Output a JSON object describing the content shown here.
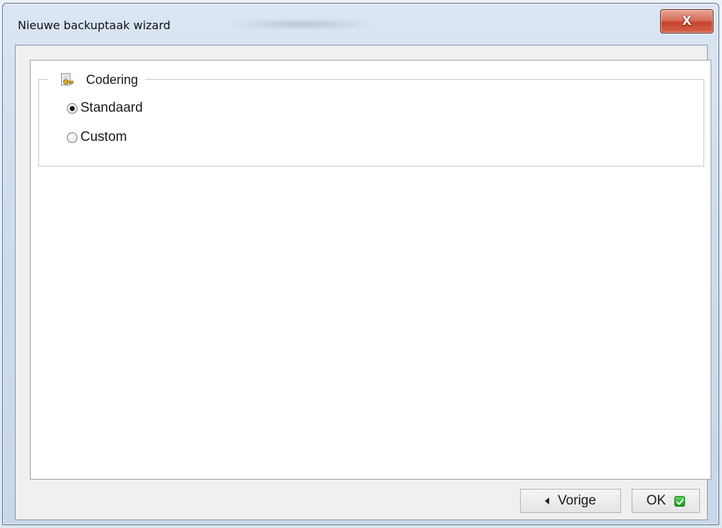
{
  "window": {
    "title": "Nieuwe backuptaak wizard",
    "close_glyph": "X"
  },
  "group": {
    "label": "Codering",
    "icon": "certificate-key-icon"
  },
  "options": [
    {
      "label": "Standaard",
      "selected": true
    },
    {
      "label": "Custom",
      "selected": false
    }
  ],
  "buttons": {
    "back_label": "Vorige",
    "ok_label": "OK"
  },
  "colors": {
    "close_button": "#c7442a",
    "ok_check": "#1e9a1e"
  }
}
